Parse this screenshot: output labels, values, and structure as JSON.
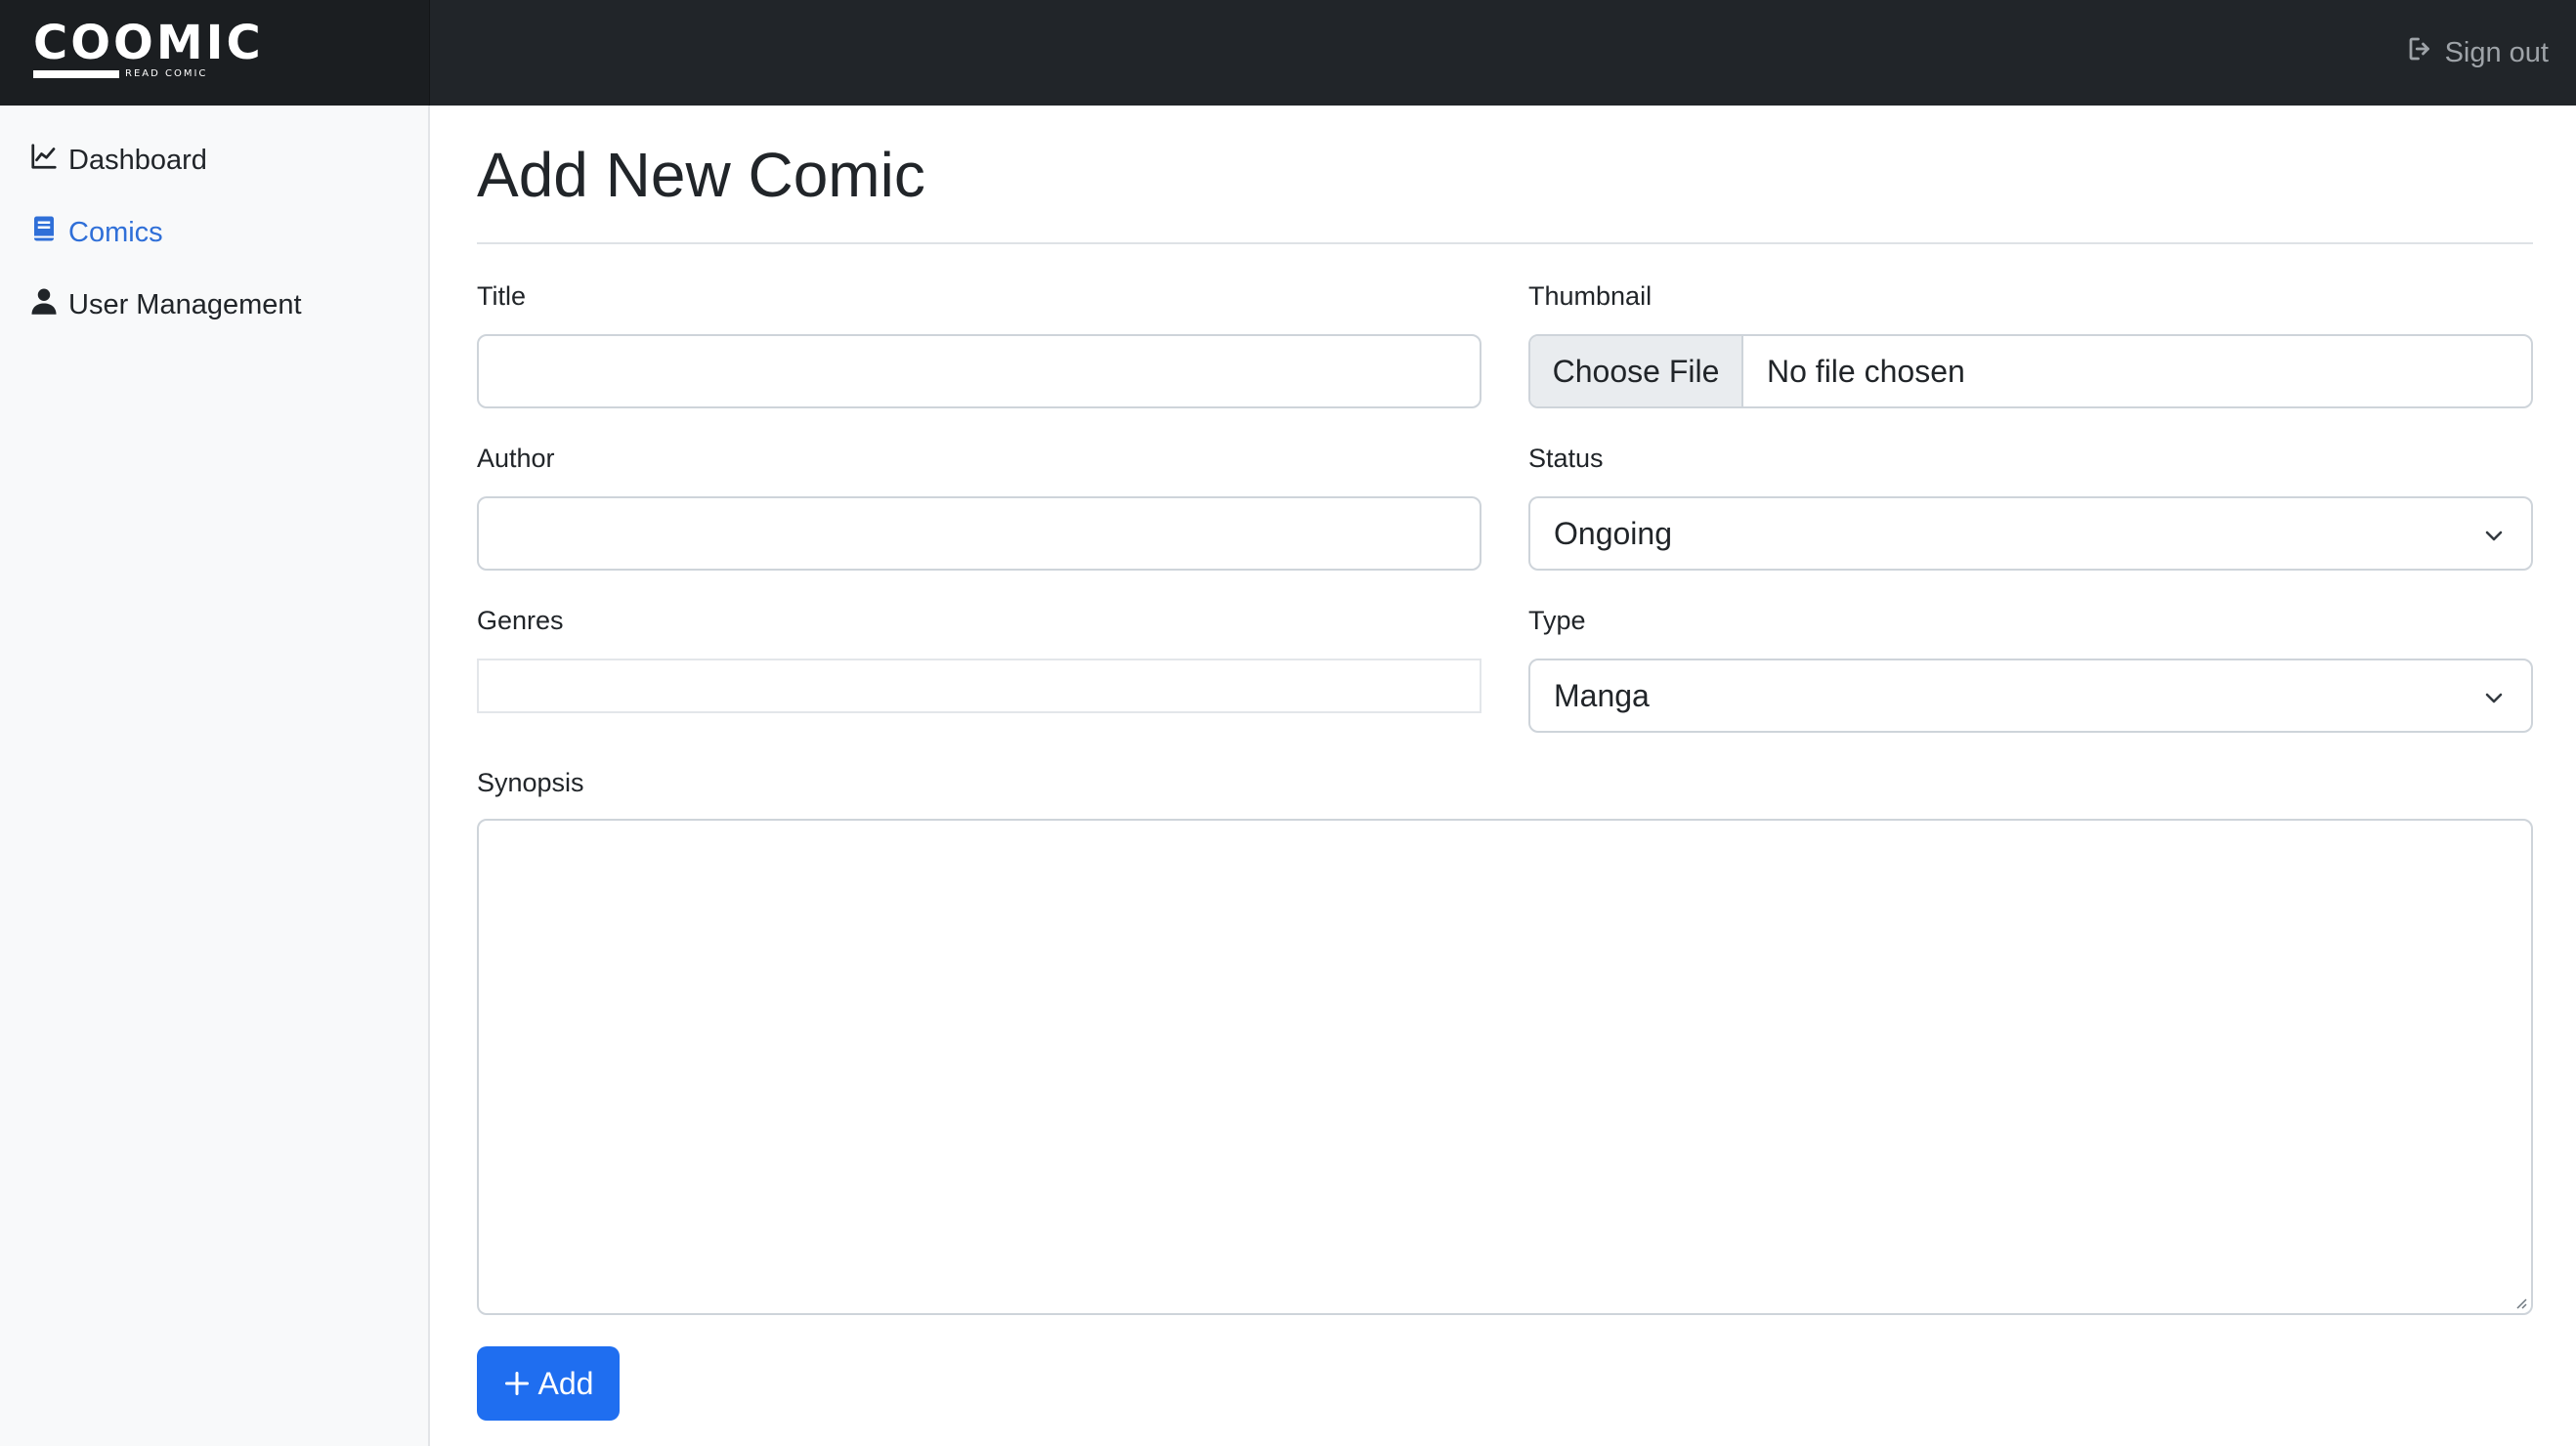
{
  "brand": {
    "name": "COOMIC",
    "tagline": "READ COMIC"
  },
  "header": {
    "signout_label": "Sign out",
    "signout_icon": "sign-out-icon"
  },
  "sidebar": {
    "items": [
      {
        "label": "Dashboard",
        "icon": "chart-line-icon",
        "active": false
      },
      {
        "label": "Comics",
        "icon": "book-icon",
        "active": true
      },
      {
        "label": "User Management",
        "icon": "user-icon",
        "active": false
      }
    ],
    "active_color": "#2f6fd8"
  },
  "main": {
    "title": "Add New Comic",
    "form": {
      "title_label": "Title",
      "title_value": "",
      "author_label": "Author",
      "author_value": "",
      "genres_label": "Genres",
      "thumbnail_label": "Thumbnail",
      "file_button": "Choose File",
      "file_status": "No file chosen",
      "status_label": "Status",
      "status_value": "Ongoing",
      "type_label": "Type",
      "type_value": "Manga",
      "synopsis_label": "Synopsis",
      "synopsis_value": "",
      "add_button": "Add"
    }
  },
  "colors": {
    "topbar": "#212529",
    "primary": "#1f6ef0"
  }
}
